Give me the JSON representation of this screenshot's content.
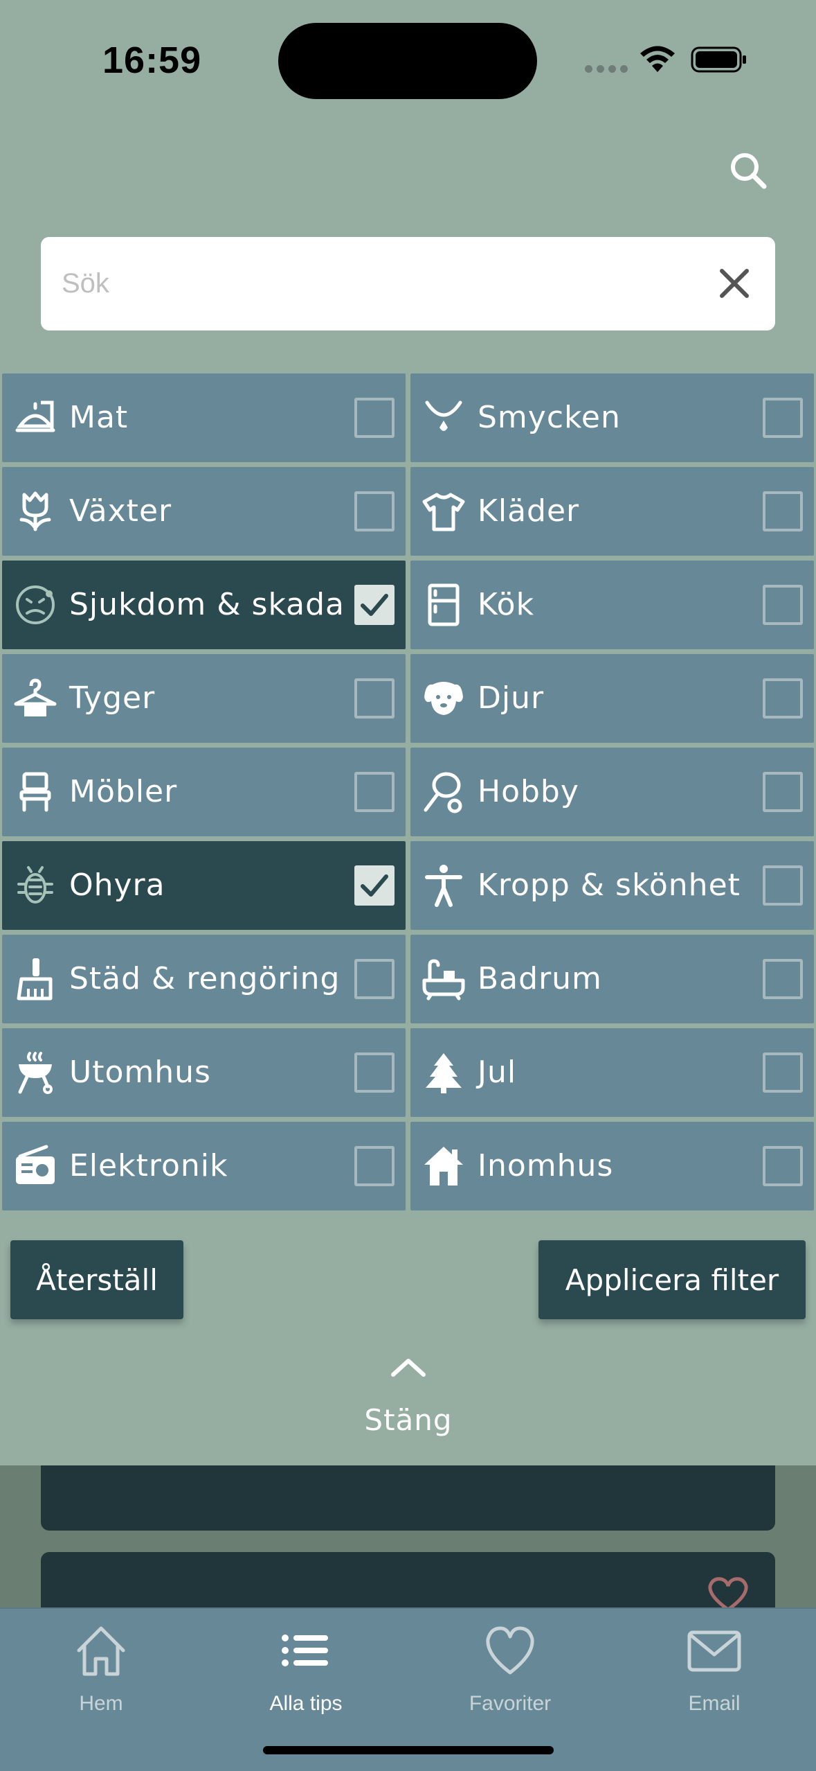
{
  "status": {
    "time": "16:59"
  },
  "search": {
    "placeholder": "Sök",
    "value": ""
  },
  "categories": [
    {
      "label": "Mat",
      "icon": "food-tray-icon",
      "checked": false
    },
    {
      "label": "Smycken",
      "icon": "necklace-icon",
      "checked": false
    },
    {
      "label": "Växter",
      "icon": "tulip-icon",
      "checked": false
    },
    {
      "label": "Kläder",
      "icon": "shirt-icon",
      "checked": false
    },
    {
      "label": "Sjukdom & skada",
      "icon": "sick-face-icon",
      "checked": true
    },
    {
      "label": "Kök",
      "icon": "fridge-icon",
      "checked": false
    },
    {
      "label": "Tyger",
      "icon": "hanger-icon",
      "checked": false
    },
    {
      "label": "Djur",
      "icon": "dog-icon",
      "checked": false
    },
    {
      "label": "Möbler",
      "icon": "chair-icon",
      "checked": false
    },
    {
      "label": "Hobby",
      "icon": "racket-icon",
      "checked": false
    },
    {
      "label": "Ohyra",
      "icon": "bug-icon",
      "checked": true
    },
    {
      "label": "Kropp & skönhet",
      "icon": "person-icon",
      "checked": false
    },
    {
      "label": "Städ & rengöring",
      "icon": "broom-icon",
      "checked": false
    },
    {
      "label": "Badrum",
      "icon": "bathtub-icon",
      "checked": false
    },
    {
      "label": "Utomhus",
      "icon": "grill-icon",
      "checked": false
    },
    {
      "label": "Jul",
      "icon": "tree-icon",
      "checked": false
    },
    {
      "label": "Elektronik",
      "icon": "radio-icon",
      "checked": false
    },
    {
      "label": "Inomhus",
      "icon": "house-icon",
      "checked": false
    }
  ],
  "actions": {
    "reset": "Återställ",
    "apply": "Applicera filter",
    "close": "Stäng"
  },
  "tabs": [
    {
      "label": "Hem",
      "icon": "home-icon",
      "active": false
    },
    {
      "label": "Alla tips",
      "icon": "list-icon",
      "active": true
    },
    {
      "label": "Favoriter",
      "icon": "heart-icon",
      "active": false
    },
    {
      "label": "Email",
      "icon": "mail-icon",
      "active": false
    }
  ],
  "colors": {
    "background": "#96aea2",
    "tile": "#678896",
    "tile_checked": "#2b4a50",
    "button": "#2b4a50",
    "tabbar": "#678896"
  }
}
